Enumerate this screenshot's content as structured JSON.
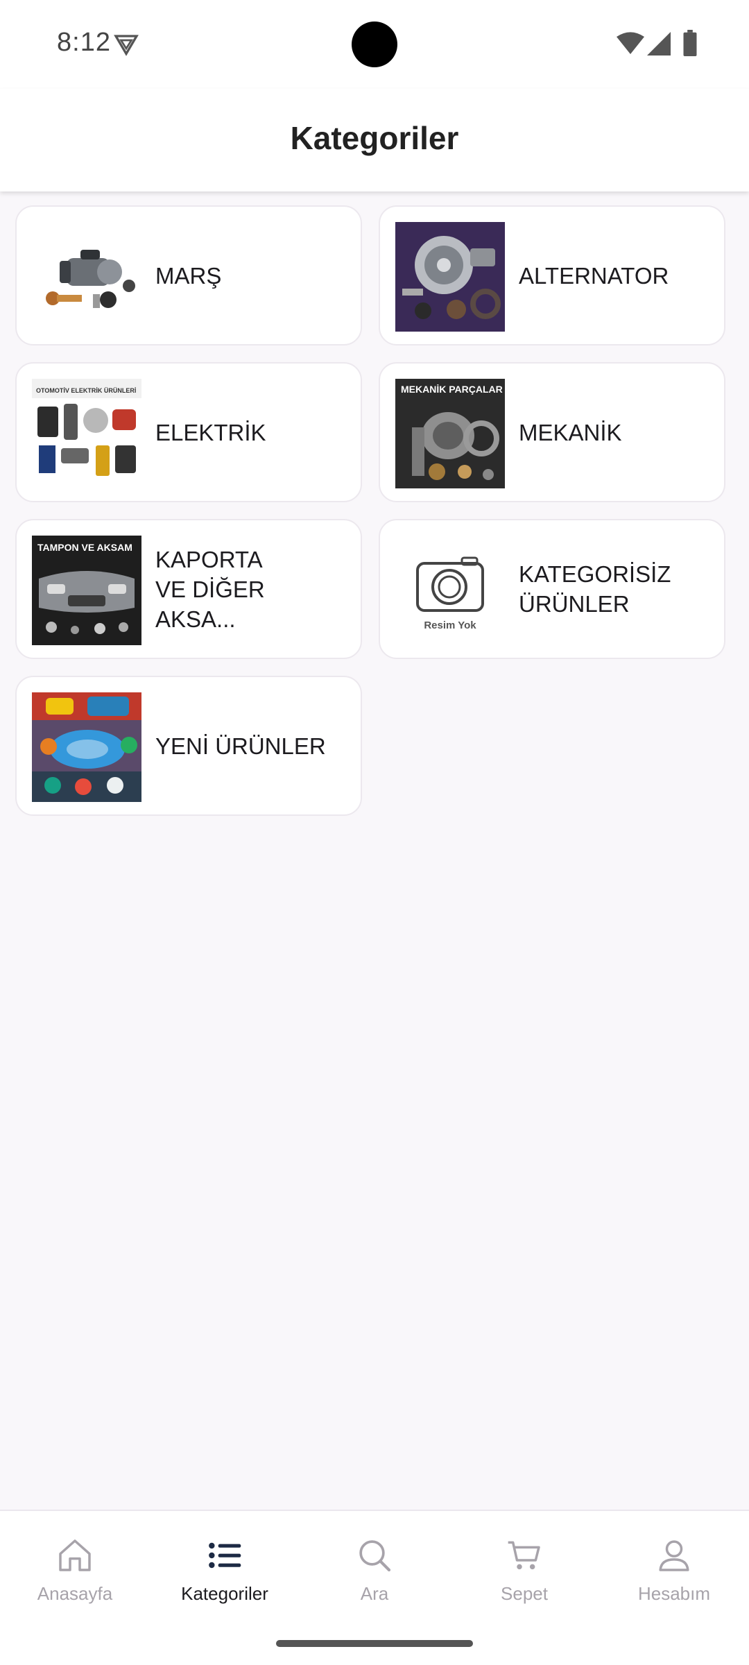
{
  "status_bar": {
    "time": "8:12",
    "icons": [
      "vpn-key-icon",
      "wifi-icon",
      "signal-icon",
      "battery-icon"
    ]
  },
  "header": {
    "title": "Kategoriler"
  },
  "categories": [
    {
      "label": "MARŞ",
      "thumb_icon": "starter-motor-photo"
    },
    {
      "label": "ALTERNATOR",
      "thumb_icon": "alternator-photo"
    },
    {
      "label": "ELEKTRİK",
      "thumb_icon": "electrical-parts-photo",
      "thumb_caption": "OTOMOTİV ELEKTRİK ÜRÜNLERİ"
    },
    {
      "label": "MEKANİK",
      "thumb_icon": "mechanical-parts-photo",
      "thumb_caption": "MEKANİK PARÇALAR"
    },
    {
      "label": "KAPORTA\nVE DİĞER AKSA...",
      "thumb_icon": "bumper-photo",
      "thumb_caption": "TAMPON VE AKSAM"
    },
    {
      "label": "KATEGORİSİZ\nÜRÜNLER",
      "thumb_icon": "camera-placeholder-icon",
      "thumb_caption": "Resim Yok"
    },
    {
      "label": "YENİ ÜRÜNLER",
      "thumb_icon": "new-products-photo"
    }
  ],
  "bottom_nav": {
    "items": [
      {
        "label": "Anasayfa",
        "icon": "home-icon",
        "active": false
      },
      {
        "label": "Kategoriler",
        "icon": "list-icon",
        "active": true
      },
      {
        "label": "Ara",
        "icon": "search-icon",
        "active": false
      },
      {
        "label": "Sepet",
        "icon": "cart-icon",
        "active": false
      },
      {
        "label": "Hesabım",
        "icon": "account-icon",
        "active": false
      }
    ]
  },
  "colors": {
    "background": "#f9f7fa",
    "active_indicator": "#1d2a44",
    "inactive_nav": "#a7a3aa"
  }
}
